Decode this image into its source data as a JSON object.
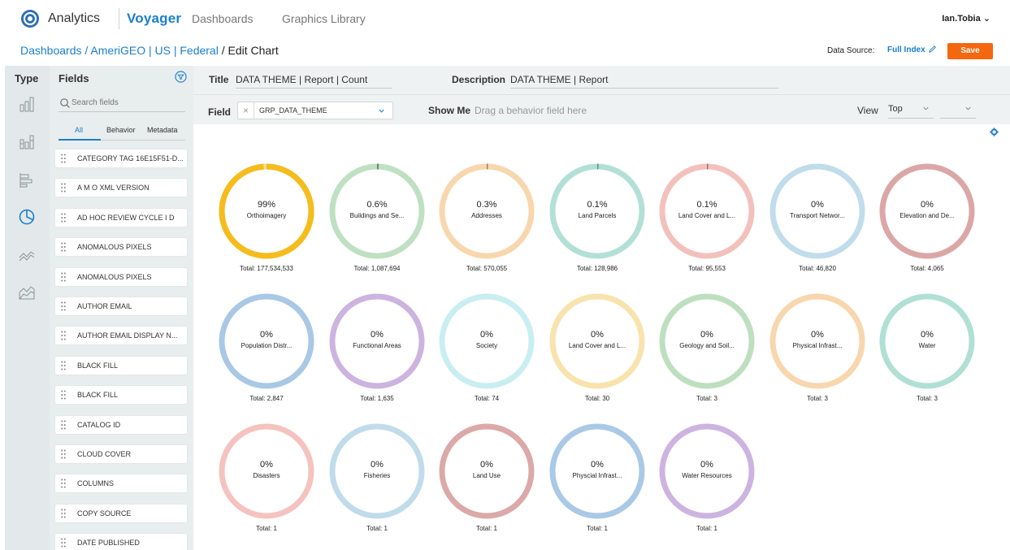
{
  "topnav": {
    "brand": "Analytics",
    "product": "Voyager",
    "links": [
      "Dashboards",
      "Graphics Library"
    ],
    "user": "Ian.Tobia ⌄"
  },
  "breadcrumb": {
    "parts": [
      "Dashboards",
      "AmeriGEO | US | Federal"
    ],
    "separator": " / ",
    "current": "Edit Chart"
  },
  "datasource": {
    "label": "Data Source:",
    "value": "Full Index"
  },
  "save_label": "Save",
  "type_panel": {
    "title": "Type",
    "icons": [
      "bar-chart-icon",
      "grouped-bar-chart-icon",
      "horizontal-bar-chart-icon",
      "pie-chart-icon",
      "line-chart-icon",
      "area-chart-icon"
    ]
  },
  "fields_panel": {
    "title": "Fields",
    "search_placeholder": "Search fields",
    "tabs": [
      "All",
      "Behavior",
      "Metadata"
    ],
    "items": [
      "CATEGORY TAG 16E15F51-D...",
      "A M O XML VERSION",
      "AD HOC REVIEW CYCLE I D",
      "ANOMALOUS PIXELS",
      "ANOMALOUS PIXELS",
      "AUTHOR EMAIL",
      "AUTHOR EMAIL DISPLAY N...",
      "BLACK FILL",
      "BLACK FILL",
      "CATALOG ID",
      "CLOUD COVER",
      "COLUMNS",
      "COPY SOURCE",
      "DATE PUBLISHED"
    ]
  },
  "editor": {
    "title_label": "Title",
    "title_value": "DATA THEME | Report | Count",
    "description_label": "Description",
    "description_value": "DATA THEME | Report",
    "field_label": "Field",
    "field_value": "GRP_DATA_THEME",
    "showme_label": "Show Me",
    "showme_hint": "Drag a behavior field here",
    "view_label": "View",
    "view_value": "Top",
    "view_value2": ""
  },
  "chart_data": {
    "type": "donut-grid",
    "items": [
      {
        "label": "Orthoimagery",
        "pct": "99%",
        "total": "Total: 177,534,533",
        "fraction": 0.99,
        "color": "#f5bc1e"
      },
      {
        "label": "Buildings and Se...",
        "pct": "0.6%",
        "total": "Total: 1,087,694",
        "fraction": 0.006,
        "color": "#bfe0c2"
      },
      {
        "label": "Addresses",
        "pct": "0.3%",
        "total": "Total: 570,055",
        "fraction": 0.003,
        "color": "#f8d7ae"
      },
      {
        "label": "Land Parcels",
        "pct": "0.1%",
        "total": "Total: 128,986",
        "fraction": 0.001,
        "color": "#b3e0d6"
      },
      {
        "label": "Land Cover and L...",
        "pct": "0.1%",
        "total": "Total: 95,553",
        "fraction": 0.001,
        "color": "#f3c1bc"
      },
      {
        "label": "Transport Networ...",
        "pct": "0%",
        "total": "Total: 46,820",
        "fraction": 0.0,
        "color": "#c1dceb"
      },
      {
        "label": "Elevation and De...",
        "pct": "0%",
        "total": "Total: 4,065",
        "fraction": 0.0,
        "color": "#dba7a6"
      },
      {
        "label": "Population Distr...",
        "pct": "0%",
        "total": "Total: 2,847",
        "fraction": 0.0,
        "color": "#a9c8e6"
      },
      {
        "label": "Functional Areas",
        "pct": "0%",
        "total": "Total: 1,635",
        "fraction": 0.0,
        "color": "#cdb3df"
      },
      {
        "label": "Society",
        "pct": "0%",
        "total": "Total: 74",
        "fraction": 0.0,
        "color": "#c9eef2"
      },
      {
        "label": "Land Cover and L...",
        "pct": "0%",
        "total": "Total: 30",
        "fraction": 0.0,
        "color": "#f8e3ad"
      },
      {
        "label": "Geology and Soil...",
        "pct": "0%",
        "total": "Total: 3",
        "fraction": 0.0,
        "color": "#bedfbf"
      },
      {
        "label": "Physical Infrast...",
        "pct": "0%",
        "total": "Total: 3",
        "fraction": 0.0,
        "color": "#f8d6ae"
      },
      {
        "label": "Water",
        "pct": "0%",
        "total": "Total: 3",
        "fraction": 0.0,
        "color": "#b0e0d3"
      },
      {
        "label": "Disasters",
        "pct": "0%",
        "total": "Total: 1",
        "fraction": 0.0,
        "color": "#f5c3bf"
      },
      {
        "label": "Fisheries",
        "pct": "0%",
        "total": "Total: 1",
        "fraction": 0.0,
        "color": "#c0dcea"
      },
      {
        "label": "Land Use",
        "pct": "0%",
        "total": "Total: 1",
        "fraction": 0.0,
        "color": "#dba9a8"
      },
      {
        "label": "Physcial Infrast...",
        "pct": "0%",
        "total": "Total: 1",
        "fraction": 0.0,
        "color": "#a9c9e6"
      },
      {
        "label": "Water Resources",
        "pct": "0%",
        "total": "Total: 1",
        "fraction": 0.0,
        "color": "#cdb4e0"
      }
    ]
  },
  "colors": {
    "accent": "#1a7fd0",
    "save": "#f5670f",
    "panel": "#e8edee"
  }
}
